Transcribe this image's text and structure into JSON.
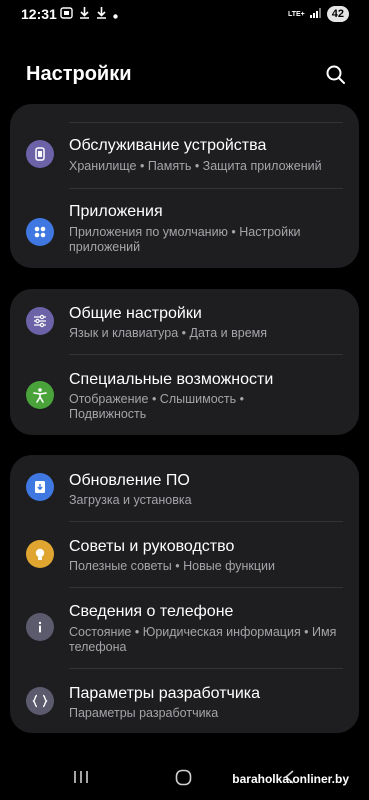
{
  "status_bar": {
    "time": "12:31",
    "network": "LTE+",
    "battery": "42"
  },
  "header": {
    "title": "Настройки"
  },
  "cards": [
    {
      "items": [
        {
          "title": "Обслуживание устройства",
          "subtitle": "Хранилище  •  Память  •  Защита приложений",
          "icon": "device-care-icon",
          "icon_color": "#6c62a8"
        },
        {
          "title": "Приложения",
          "subtitle": "Приложения по умолчанию  •  Настройки приложений",
          "icon": "apps-icon",
          "icon_color": "#3f78e0"
        }
      ]
    },
    {
      "items": [
        {
          "title": "Общие настройки",
          "subtitle": "Язык и клавиатура  •  Дата и время",
          "icon": "general-settings-icon",
          "icon_color": "#6c62a8"
        },
        {
          "title": "Специальные возможности",
          "subtitle": "Отображение  •  Слышимость  •  Подвижность",
          "icon": "accessibility-icon",
          "icon_color": "#49a33a"
        }
      ]
    },
    {
      "items": [
        {
          "title": "Обновление ПО",
          "subtitle": "Загрузка и установка",
          "icon": "software-update-icon",
          "icon_color": "#3f78e0"
        },
        {
          "title": "Советы и руководство",
          "subtitle": "Полезные советы  •  Новые функции",
          "icon": "tips-icon",
          "icon_color": "#e0a531"
        },
        {
          "title": "Сведения о телефоне",
          "subtitle": "Состояние  •  Юридическая информация  •  Имя телефона",
          "icon": "about-phone-icon",
          "icon_color": "#5c5b6e"
        },
        {
          "title": "Параметры разработчика",
          "subtitle": "Параметры разработчика",
          "icon": "developer-options-icon",
          "icon_color": "#5c5b6e"
        }
      ]
    }
  ],
  "watermark": "baraholka.onliner.by"
}
